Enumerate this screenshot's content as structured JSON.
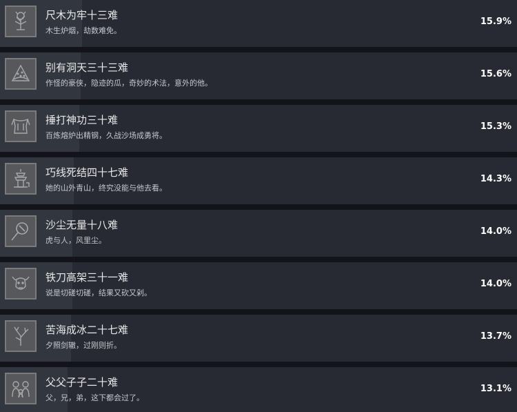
{
  "achievements": [
    {
      "title": "尺木为牢十三难",
      "desc": "木生炉烟，劫数难免。",
      "percent": "15.9%",
      "progress": 15.9,
      "icon": "tree-lantern-icon"
    },
    {
      "title": "别有洞天三十三难",
      "desc": "作怪的豪侠，隐迹的瓜，奇妙的术法，意外的他。",
      "percent": "15.6%",
      "progress": 15.6,
      "icon": "melon-slice-icon"
    },
    {
      "title": "捶打神功三十难",
      "desc": "百炼熔炉出精钢，久战沙场成勇将。",
      "percent": "15.3%",
      "progress": 15.3,
      "icon": "armor-icon"
    },
    {
      "title": "巧线死结四十七难",
      "desc": "她的山外青山，终究没能与他去看。",
      "percent": "14.3%",
      "progress": 14.3,
      "icon": "pagoda-icon"
    },
    {
      "title": "沙尘无量十八难",
      "desc": "虎与人，风里尘。",
      "percent": "14.0%",
      "progress": 14.0,
      "icon": "magnifier-icon"
    },
    {
      "title": "铁刀高架三十一难",
      "desc": "说是切磋切磋，结果又砍又剁。",
      "percent": "14.0%",
      "progress": 14.0,
      "icon": "ox-head-icon"
    },
    {
      "title": "苦海成冰二十七难",
      "desc": "夕照剑辙，过刚则折。",
      "percent": "13.7%",
      "progress": 13.7,
      "icon": "coral-branch-icon"
    },
    {
      "title": "父父子子二十难",
      "desc": "父，兄，弟，这下都会过了。",
      "percent": "13.1%",
      "progress": 13.1,
      "icon": "monkey-family-icon"
    }
  ]
}
